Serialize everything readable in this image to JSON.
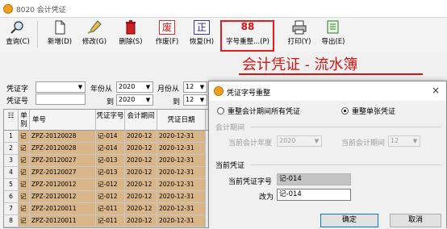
{
  "window": {
    "title": "8020 会计凭证"
  },
  "toolbar": {
    "query": "查询(C)",
    "new": "新增(D)",
    "edit": "修改(G)",
    "delete": "删除(S)",
    "void_icon": "废",
    "void": "作废(F)",
    "restore_icon": "正",
    "restore": "恢复(H)",
    "renumber_icon": "88",
    "renumber": "字号重整...(P)",
    "print": "打印(Y)",
    "export": "导出(E)"
  },
  "banner": {
    "title": "会计凭证 - 流水簿"
  },
  "filters": {
    "voucher_word_label": "凭证字",
    "voucher_word_value": "",
    "voucher_no_label": "凭证号",
    "year_from_label": "年份从",
    "year_from": "2020",
    "year_to_label": "到",
    "year_to": "2020",
    "month_from_label": "月份从",
    "month_from": "12",
    "month_to_label": "到",
    "month_to": "12"
  },
  "grid": {
    "headers": [
      "单别",
      "单号",
      "凭证字号",
      "会计期间",
      "凭证日期"
    ],
    "rows": [
      {
        "no": "1",
        "kind": "记",
        "doc": "ZPZ-20120028",
        "word": "记-014",
        "period": "2020-12",
        "date": "2020-12-31"
      },
      {
        "no": "2",
        "kind": "记",
        "doc": "ZPZ-20120028",
        "word": "记-014",
        "period": "2020-12",
        "date": "2020-12-31"
      },
      {
        "no": "3",
        "kind": "记",
        "doc": "ZPZ-20120027",
        "word": "记-013",
        "period": "2020-12",
        "date": "2020-12-31"
      },
      {
        "no": "4",
        "kind": "记",
        "doc": "ZPZ-20120027",
        "word": "记-013",
        "period": "2020-12",
        "date": "2020-12-31"
      },
      {
        "no": "5",
        "kind": "记",
        "doc": "ZPZ-20120012",
        "word": "记-012",
        "period": "2020-12",
        "date": "2020-12-31"
      },
      {
        "no": "6",
        "kind": "记",
        "doc": "ZPZ-20120012",
        "word": "记-012",
        "period": "2020-12",
        "date": "2020-12-31"
      },
      {
        "no": "7",
        "kind": "记",
        "doc": "ZPZ-20120011",
        "word": "记-011",
        "period": "2020-12",
        "date": "2020-12-31"
      },
      {
        "no": "8",
        "kind": "记",
        "doc": "ZPZ-20120011",
        "word": "记-011",
        "period": "2020-12",
        "date": "2020-12-31"
      }
    ]
  },
  "dialog": {
    "title": "凭证字号重整",
    "close": "×",
    "option_all": "重整会计期间所有凭证",
    "option_single": "重整单张凭证",
    "selected": "single",
    "period_group": "会计期间",
    "cur_year_label": "当前会计年度",
    "cur_year": "2020",
    "cur_period_label": "当前会计期间",
    "cur_period": "12",
    "voucher_group": "当前凭证",
    "cur_word_label": "当前凭证字号",
    "cur_word": "记-014",
    "change_to_label": "改为",
    "change_to": "记-014",
    "ok": "确定",
    "cancel": "取消"
  },
  "colors": {
    "accent_red": "#d21616",
    "row_tan": "#d9b58a",
    "highlight": "#e02020"
  }
}
